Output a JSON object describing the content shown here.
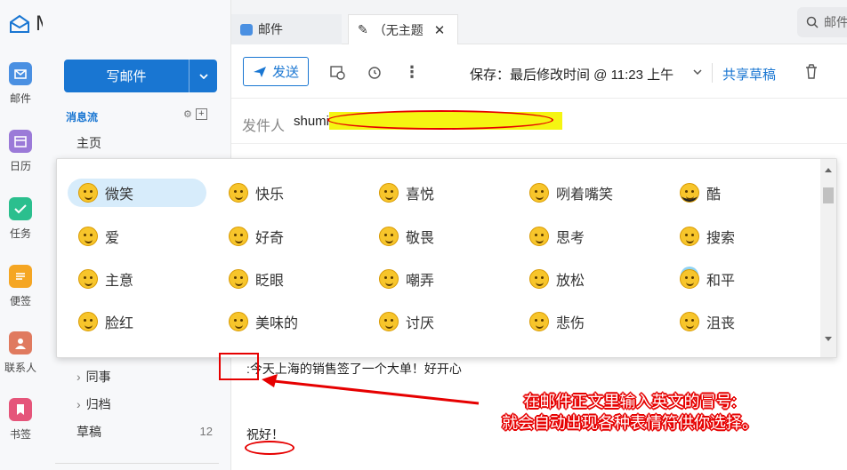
{
  "app": {
    "title": "Mail"
  },
  "rail": {
    "items": [
      {
        "label": "邮件",
        "icon": "mail-icon",
        "color": "#4a90e2"
      },
      {
        "label": "日历",
        "icon": "calendar-icon",
        "color": "#9b7ad8"
      },
      {
        "label": "任务",
        "icon": "task-icon",
        "color": "#2bbf8e"
      },
      {
        "label": "便签",
        "icon": "note-icon",
        "color": "#f5a623"
      },
      {
        "label": "联系人",
        "icon": "contact-icon",
        "color": "#e07a5f"
      },
      {
        "label": "书签",
        "icon": "bookmark-icon",
        "color": "#e5557a"
      }
    ]
  },
  "folders": {
    "compose_label": "写邮件",
    "stream_title": "消息流",
    "home": "主页",
    "coworkers": "同事",
    "archive": "归档",
    "drafts": "草稿",
    "drafts_count": "12"
  },
  "tabs": [
    {
      "label": "邮件"
    },
    {
      "label": "（无主题"
    }
  ],
  "search": {
    "placeholder": "邮件"
  },
  "toolbar": {
    "send_label": "发送",
    "save_status": "保存：最后修改时间 @ 11:23 上午",
    "share_label": "共享草稿"
  },
  "from": {
    "label": "发件人",
    "value": "shumin.sun"
  },
  "emoji_popup": {
    "items": [
      {
        "label": "微笑",
        "selected": true
      },
      {
        "label": "快乐"
      },
      {
        "label": "喜悦"
      },
      {
        "label": "咧着嘴笑"
      },
      {
        "label": "酷"
      },
      {
        "label": "爱"
      },
      {
        "label": "好奇"
      },
      {
        "label": "敬畏"
      },
      {
        "label": "思考"
      },
      {
        "label": "搜索"
      },
      {
        "label": "主意"
      },
      {
        "label": "眨眼"
      },
      {
        "label": "嘲弄"
      },
      {
        "label": "放松"
      },
      {
        "label": "和平"
      },
      {
        "label": "脸红"
      },
      {
        "label": "美味的"
      },
      {
        "label": "讨厌"
      },
      {
        "label": "悲伤"
      },
      {
        "label": "沮丧"
      }
    ]
  },
  "body": {
    "line1": ":今天上海的销售签了一个大单！好开心",
    "line2": "祝好！"
  },
  "annotation": {
    "line1": "在邮件正文里输入英文的冒号:",
    "line2": "就会自动出现各种表情符供你选择。"
  },
  "colors": {
    "accent": "#1976d2",
    "annotation": "#e60000",
    "highlight": "#f5f512"
  }
}
